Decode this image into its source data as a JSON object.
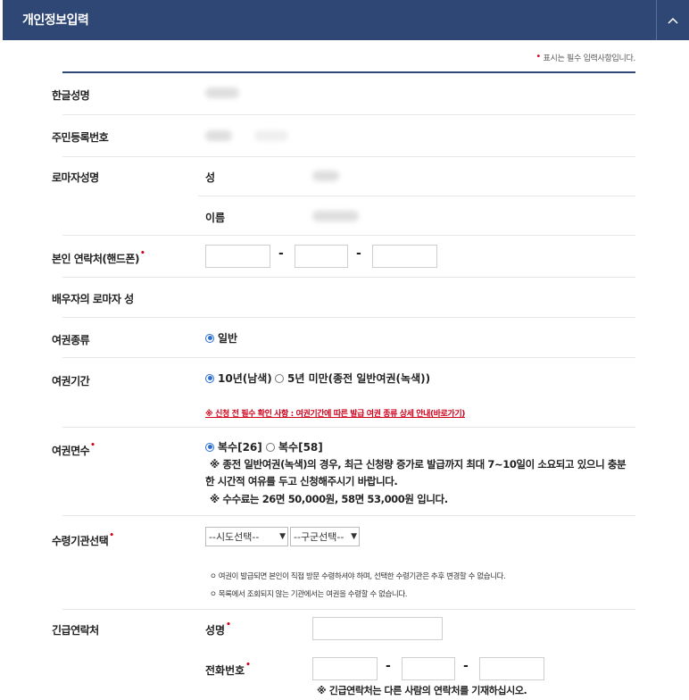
{
  "header": {
    "title": "개인정보입력",
    "toggle": "^"
  },
  "notice": {
    "mark": "•",
    "text": "표시는 필수 입력사항입니다."
  },
  "fields": {
    "korean_name": "한글성명",
    "resident_no": "주민등록번호",
    "roman_name": "로마자성명",
    "roman_surname": "성",
    "roman_given": "이름",
    "phone": "본인 연락처(핸드폰)",
    "spouse_roman": "배우자의 로마자 성",
    "passport_type": "여권종류",
    "passport_period": "여권기간",
    "passport_copies": "여권면수",
    "pickup_office": "수령기관선택",
    "emergency": "긴급연락처",
    "emergency_name": "성명",
    "emergency_phone": "전화번호"
  },
  "dash": "-",
  "required_mark": "•",
  "passport_type_options": [
    {
      "label": "일반",
      "selected": true
    }
  ],
  "period_options": [
    {
      "label": "10년(남색)",
      "selected": true
    },
    {
      "label": "5년 미만(종전 일반여권(녹색))",
      "selected": false
    }
  ],
  "period_notice": "※ 신청 전 필수 확인 사항 : 여권기간에 따른 발급 여권 종류 상세 안내(바로가기)",
  "copies_options": [
    {
      "label": "복수[26]",
      "selected": true
    },
    {
      "label": "복수[58]",
      "selected": false
    }
  ],
  "copies_notes": {
    "line1": "※ 종전 일반여권(녹색)의 경우, 최근 신청량 증가로 발급까지 최대 7~10일이 소요되고 있으니 충분",
    "line2": "한 시간적 여유를 두고 신청해주시기 바랍니다.",
    "line3": "※ 수수료는 26면 50,000원, 58면 53,000원 입니다."
  },
  "pickup": {
    "select_city": "--시도선택--",
    "select_district": "--구군선택--",
    "note1": "ㅇ 여권이 발급되면 본인이 직접 방문 수령하셔야 하며, 선택한 수령기관은 추후 변경할 수 없습니다.",
    "note2": "ㅇ 목록에서 조회되지 않는 기관에서는 여권을 수령할 수 없습니다."
  },
  "emergency_note": "※ 긴급연락처는 다른 사람의 연락처를 기재하십시오."
}
